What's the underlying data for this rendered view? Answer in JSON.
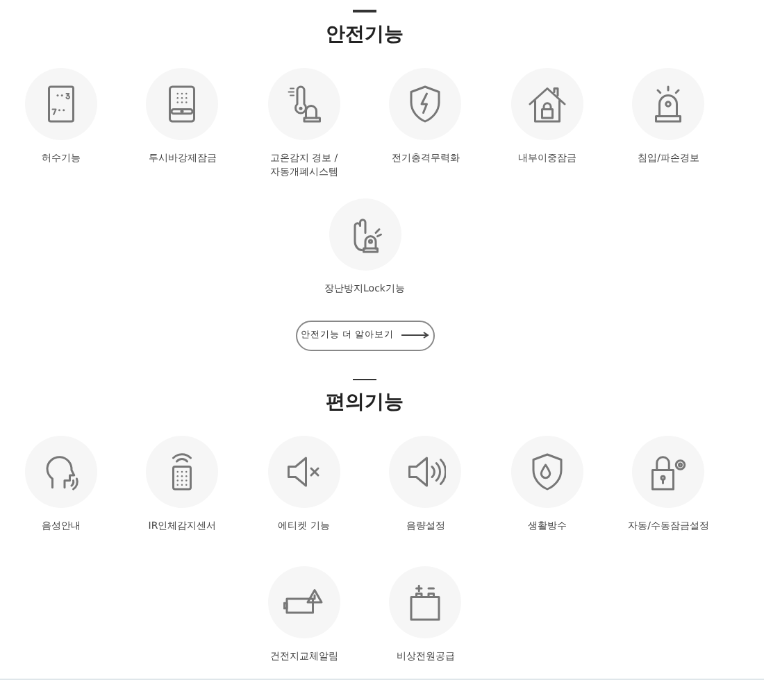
{
  "sections": [
    {
      "title": "안전기능",
      "items": [
        {
          "label": "허수기능"
        },
        {
          "label": "투시바강제잠금"
        },
        {
          "label": "고온감지 경보 /\n자동개폐시스템"
        },
        {
          "label": "전기충격무력화"
        },
        {
          "label": "내부이중잠금"
        },
        {
          "label": "침입/파손경보"
        },
        {
          "label": "장난방지Lock기능"
        }
      ],
      "more_button": {
        "label": "안전기능 더 알아보기"
      }
    },
    {
      "title": "편의기능",
      "items": [
        {
          "label": "음성안내"
        },
        {
          "label": "IR인체감지센서"
        },
        {
          "label": "에티켓 기능"
        },
        {
          "label": "음량설정"
        },
        {
          "label": "생활방수"
        },
        {
          "label": "자동/수동잠금설정"
        },
        {
          "label": "건전지교체알림"
        },
        {
          "label": "비상전원공급"
        }
      ]
    }
  ]
}
